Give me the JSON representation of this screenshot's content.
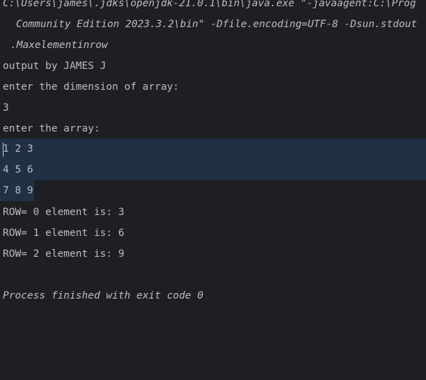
{
  "console": {
    "command_lines": [
      "C:\\Users\\james\\.jdks\\openjdk-21.0.1\\bin\\java.exe \"-javaagent:C:\\Prog",
      "Community Edition 2023.3.2\\bin\" -Dfile.encoding=UTF-8 -Dsun.stdout",
      ".Maxelementinrow"
    ],
    "output_lines": [
      "output by JAMES J",
      "enter the dimension of array:",
      "3",
      "enter the array:",
      "1 2 3",
      "4 5 6",
      "7 8 9",
      "ROW= 0 element is: 3",
      "ROW= 1 element is: 6",
      "ROW= 2 element is: 9",
      "",
      "Process finished with exit code 0"
    ],
    "colors": {
      "background": "#1e1f22",
      "text": "#bcbec4",
      "selection": "#203045"
    }
  }
}
